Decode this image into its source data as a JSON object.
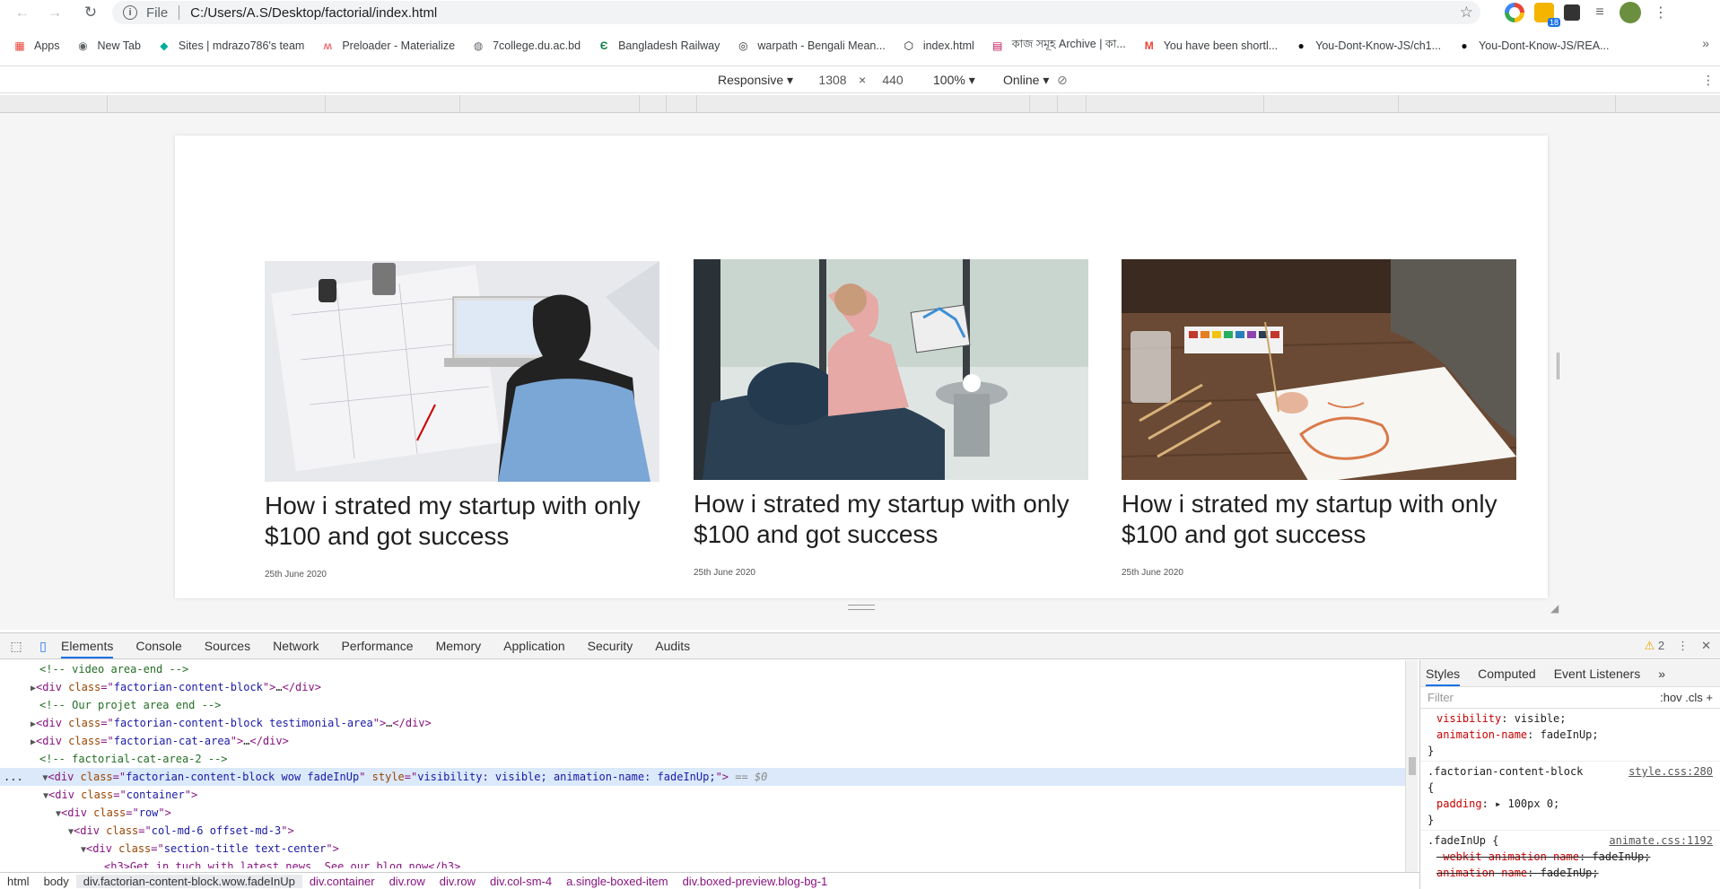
{
  "browser": {
    "url_scheme": "File",
    "url": "C:/Users/A.S/Desktop/factorial/index.html",
    "ext_badge": "18"
  },
  "bookmarks": [
    {
      "label": "Apps",
      "icon": "apps-grid-icon"
    },
    {
      "label": "New Tab",
      "icon": "chrome-icon"
    },
    {
      "label": "Sites | mdrazo786's team",
      "icon": "netlify-icon"
    },
    {
      "label": "Preloader - Materialize",
      "icon": "materialize-icon"
    },
    {
      "label": "7college.du.ac.bd",
      "icon": "globe-icon"
    },
    {
      "label": "Bangladesh Railway",
      "icon": "railway-icon"
    },
    {
      "label": "warpath - Bengali Mean...",
      "icon": "dictionary-icon"
    },
    {
      "label": "index.html",
      "icon": "codepen-icon"
    },
    {
      "label": "কাজ সমূহ Archive | কা...",
      "icon": "archive-icon"
    },
    {
      "label": "You have been shortl...",
      "icon": "gmail-icon"
    },
    {
      "label": "You-Dont-Know-JS/ch1...",
      "icon": "github-icon"
    },
    {
      "label": "You-Dont-Know-JS/REA...",
      "icon": "github-icon"
    }
  ],
  "device_toolbar": {
    "device": "Responsive",
    "width": "1308",
    "x": "×",
    "height": "440",
    "zoom": "100%",
    "throttle": "Online"
  },
  "cards": [
    {
      "title": "How i strated my startup with only $100 and got success",
      "date": "25th June 2020",
      "image": "man-at-laptop-blueprints"
    },
    {
      "title": "How i strated my startup with only $100 and got success",
      "date": "25th June 2020",
      "image": "man-on-sofa-tablet"
    },
    {
      "title": "How i strated my startup with only $100 and got success",
      "date": "25th June 2020",
      "image": "artist-painting-watercolor"
    }
  ],
  "devtools": {
    "tabs": [
      "Elements",
      "Console",
      "Sources",
      "Network",
      "Performance",
      "Memory",
      "Application",
      "Security",
      "Audits"
    ],
    "warnings": "2",
    "styles_tabs": [
      "Styles",
      "Computed",
      "Event Listeners"
    ],
    "filter_placeholder": "Filter",
    "filter_ctrls": ":hov  .cls  +"
  },
  "dom_lines": [
    {
      "indent": 36,
      "tri": "",
      "html": "cmt",
      "text": "<!-- video area-end -->"
    },
    {
      "indent": 26,
      "tri": "▶",
      "html": "collapsed",
      "cls": "factorian-content-block"
    },
    {
      "indent": 36,
      "tri": "",
      "html": "cmt",
      "text": "<!-- Our projet area end -->"
    },
    {
      "indent": 26,
      "tri": "▶",
      "html": "collapsed",
      "cls": "factorian-content-block testimonial-area"
    },
    {
      "indent": 26,
      "tri": "▶",
      "html": "collapsed",
      "cls": "factorian-cat-area"
    },
    {
      "indent": 36,
      "tri": "",
      "html": "cmt",
      "text": "<!-- factorial-cat-area-2 -->"
    }
  ],
  "selected_line": {
    "prefix": "...",
    "cls": "factorian-content-block wow fadeInUp",
    "style": "visibility: visible; animation-name: fadeInUp;",
    "suffix": "== $0"
  },
  "child_lines": [
    {
      "indent": 38,
      "cls": "container",
      "open": true
    },
    {
      "indent": 50,
      "cls": "row",
      "open": true
    },
    {
      "indent": 62,
      "cls": "col-md-6 offset-md-3",
      "open": true
    },
    {
      "indent": 74,
      "cls": "section-title text-center",
      "open": true
    }
  ],
  "partial_line": "<h3>Get in tuch with latest news. See our blog now</h3>",
  "style_rules": {
    "first": {
      "p1": "visibility",
      "v1": "visible;",
      "p2": "animation-name",
      "v2": "fadeInUp;"
    },
    "second": {
      "selector": ".factorian-content-block",
      "src": "style.css:280",
      "prop": "padding",
      "val": "100px 0;"
    },
    "third": {
      "selector": ".fadeInUp {",
      "src": "animate.css:1192",
      "p1": "-webkit-animation-name",
      "v1": "fadeInUp;",
      "p2": "animation-name",
      "v2": "fadeInUp;"
    }
  },
  "breadcrumbs": [
    "html",
    "body",
    "div.factorian-content-block.wow.fadeInUp",
    "div.container",
    "div.row",
    "div.row",
    "div.col-sm-4",
    "a.single-boxed-item",
    "div.boxed-preview.blog-bg-1"
  ]
}
